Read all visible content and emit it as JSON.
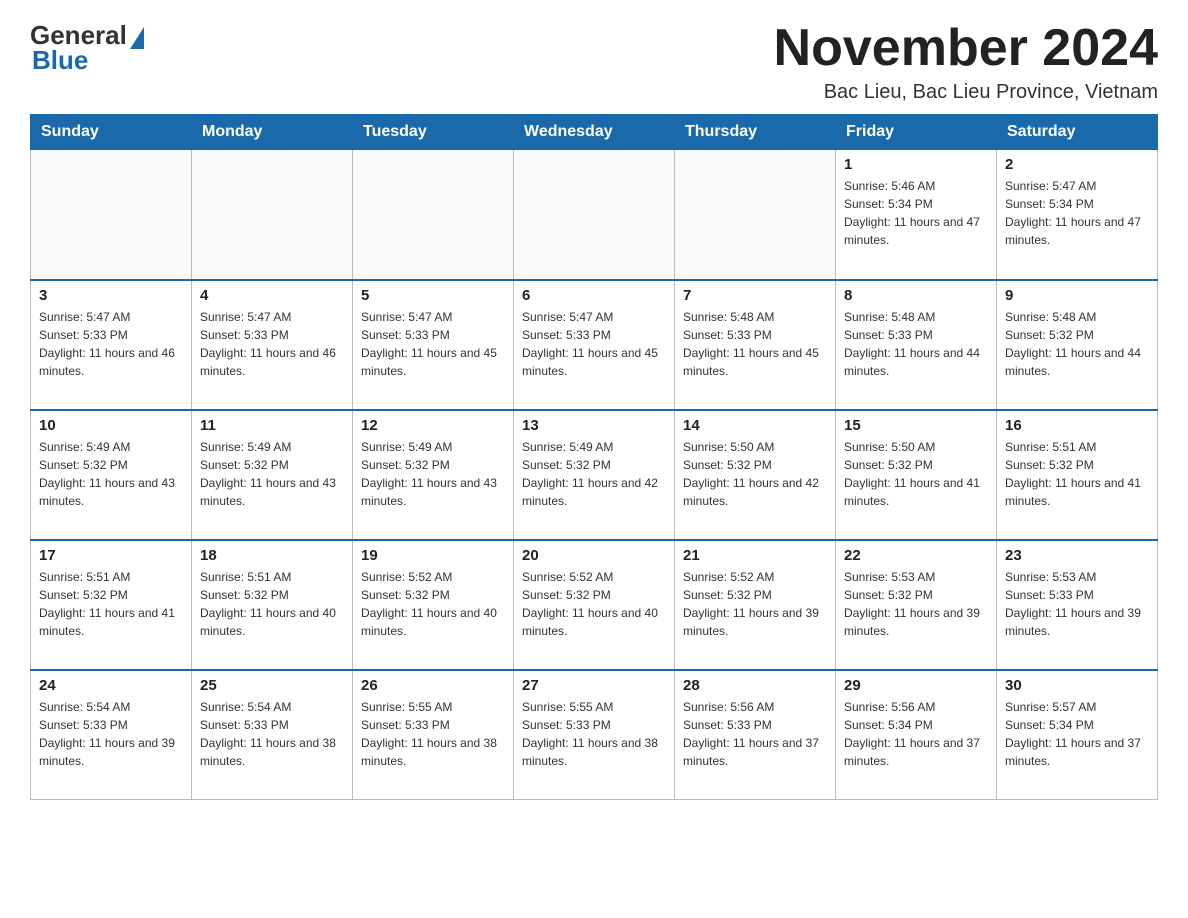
{
  "logo": {
    "general": "General",
    "blue": "Blue"
  },
  "header": {
    "title": "November 2024",
    "subtitle": "Bac Lieu, Bac Lieu Province, Vietnam"
  },
  "weekdays": [
    "Sunday",
    "Monday",
    "Tuesday",
    "Wednesday",
    "Thursday",
    "Friday",
    "Saturday"
  ],
  "weeks": [
    [
      {
        "day": "",
        "info": ""
      },
      {
        "day": "",
        "info": ""
      },
      {
        "day": "",
        "info": ""
      },
      {
        "day": "",
        "info": ""
      },
      {
        "day": "",
        "info": ""
      },
      {
        "day": "1",
        "info": "Sunrise: 5:46 AM\nSunset: 5:34 PM\nDaylight: 11 hours and 47 minutes."
      },
      {
        "day": "2",
        "info": "Sunrise: 5:47 AM\nSunset: 5:34 PM\nDaylight: 11 hours and 47 minutes."
      }
    ],
    [
      {
        "day": "3",
        "info": "Sunrise: 5:47 AM\nSunset: 5:33 PM\nDaylight: 11 hours and 46 minutes."
      },
      {
        "day": "4",
        "info": "Sunrise: 5:47 AM\nSunset: 5:33 PM\nDaylight: 11 hours and 46 minutes."
      },
      {
        "day": "5",
        "info": "Sunrise: 5:47 AM\nSunset: 5:33 PM\nDaylight: 11 hours and 45 minutes."
      },
      {
        "day": "6",
        "info": "Sunrise: 5:47 AM\nSunset: 5:33 PM\nDaylight: 11 hours and 45 minutes."
      },
      {
        "day": "7",
        "info": "Sunrise: 5:48 AM\nSunset: 5:33 PM\nDaylight: 11 hours and 45 minutes."
      },
      {
        "day": "8",
        "info": "Sunrise: 5:48 AM\nSunset: 5:33 PM\nDaylight: 11 hours and 44 minutes."
      },
      {
        "day": "9",
        "info": "Sunrise: 5:48 AM\nSunset: 5:32 PM\nDaylight: 11 hours and 44 minutes."
      }
    ],
    [
      {
        "day": "10",
        "info": "Sunrise: 5:49 AM\nSunset: 5:32 PM\nDaylight: 11 hours and 43 minutes."
      },
      {
        "day": "11",
        "info": "Sunrise: 5:49 AM\nSunset: 5:32 PM\nDaylight: 11 hours and 43 minutes."
      },
      {
        "day": "12",
        "info": "Sunrise: 5:49 AM\nSunset: 5:32 PM\nDaylight: 11 hours and 43 minutes."
      },
      {
        "day": "13",
        "info": "Sunrise: 5:49 AM\nSunset: 5:32 PM\nDaylight: 11 hours and 42 minutes."
      },
      {
        "day": "14",
        "info": "Sunrise: 5:50 AM\nSunset: 5:32 PM\nDaylight: 11 hours and 42 minutes."
      },
      {
        "day": "15",
        "info": "Sunrise: 5:50 AM\nSunset: 5:32 PM\nDaylight: 11 hours and 41 minutes."
      },
      {
        "day": "16",
        "info": "Sunrise: 5:51 AM\nSunset: 5:32 PM\nDaylight: 11 hours and 41 minutes."
      }
    ],
    [
      {
        "day": "17",
        "info": "Sunrise: 5:51 AM\nSunset: 5:32 PM\nDaylight: 11 hours and 41 minutes."
      },
      {
        "day": "18",
        "info": "Sunrise: 5:51 AM\nSunset: 5:32 PM\nDaylight: 11 hours and 40 minutes."
      },
      {
        "day": "19",
        "info": "Sunrise: 5:52 AM\nSunset: 5:32 PM\nDaylight: 11 hours and 40 minutes."
      },
      {
        "day": "20",
        "info": "Sunrise: 5:52 AM\nSunset: 5:32 PM\nDaylight: 11 hours and 40 minutes."
      },
      {
        "day": "21",
        "info": "Sunrise: 5:52 AM\nSunset: 5:32 PM\nDaylight: 11 hours and 39 minutes."
      },
      {
        "day": "22",
        "info": "Sunrise: 5:53 AM\nSunset: 5:32 PM\nDaylight: 11 hours and 39 minutes."
      },
      {
        "day": "23",
        "info": "Sunrise: 5:53 AM\nSunset: 5:33 PM\nDaylight: 11 hours and 39 minutes."
      }
    ],
    [
      {
        "day": "24",
        "info": "Sunrise: 5:54 AM\nSunset: 5:33 PM\nDaylight: 11 hours and 39 minutes."
      },
      {
        "day": "25",
        "info": "Sunrise: 5:54 AM\nSunset: 5:33 PM\nDaylight: 11 hours and 38 minutes."
      },
      {
        "day": "26",
        "info": "Sunrise: 5:55 AM\nSunset: 5:33 PM\nDaylight: 11 hours and 38 minutes."
      },
      {
        "day": "27",
        "info": "Sunrise: 5:55 AM\nSunset: 5:33 PM\nDaylight: 11 hours and 38 minutes."
      },
      {
        "day": "28",
        "info": "Sunrise: 5:56 AM\nSunset: 5:33 PM\nDaylight: 11 hours and 37 minutes."
      },
      {
        "day": "29",
        "info": "Sunrise: 5:56 AM\nSunset: 5:34 PM\nDaylight: 11 hours and 37 minutes."
      },
      {
        "day": "30",
        "info": "Sunrise: 5:57 AM\nSunset: 5:34 PM\nDaylight: 11 hours and 37 minutes."
      }
    ]
  ]
}
